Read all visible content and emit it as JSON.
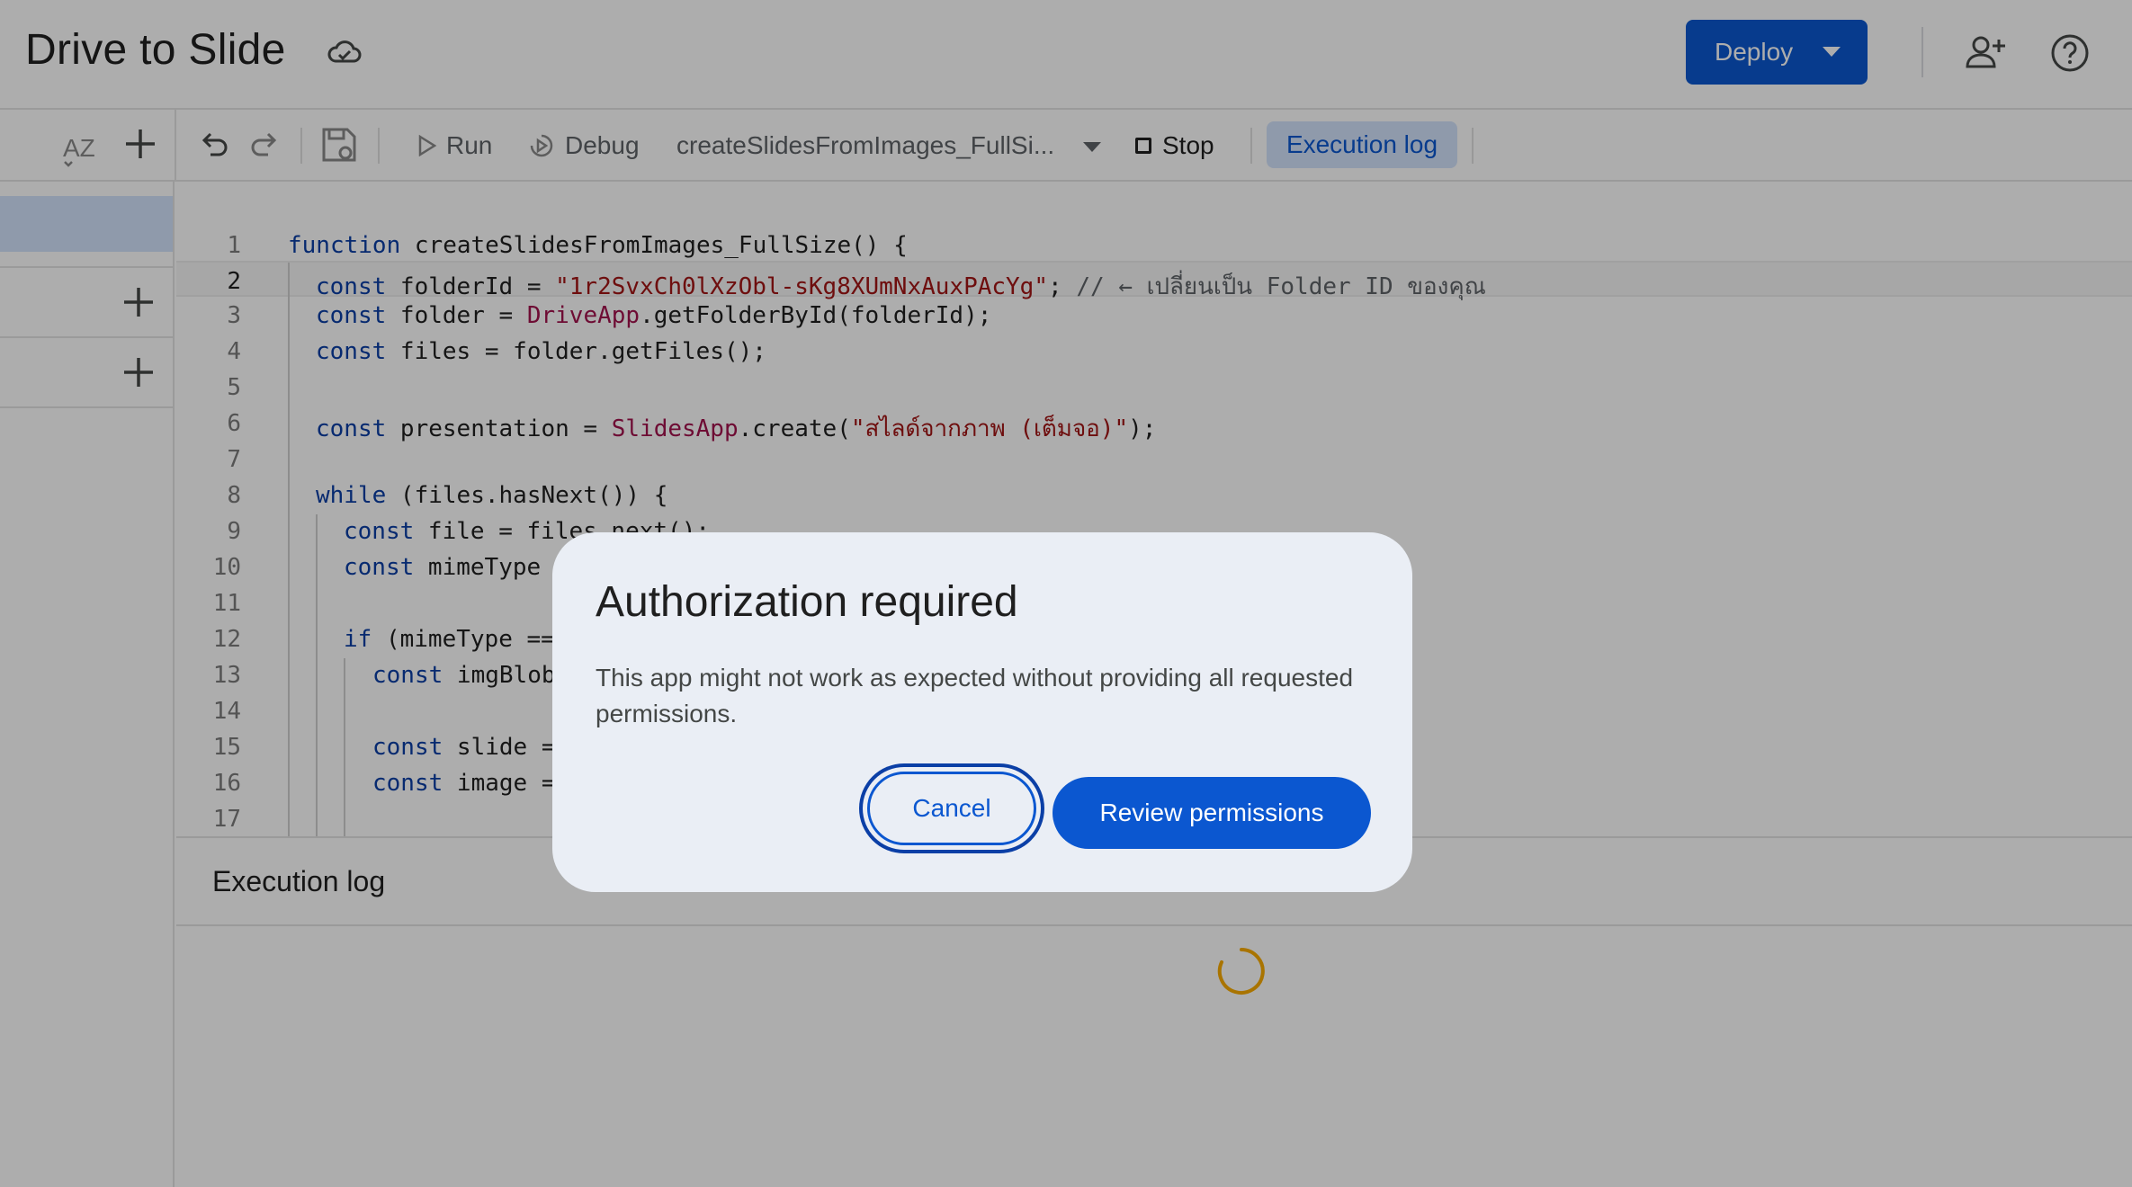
{
  "app": {
    "title": "Drive to Slide",
    "cloud_icon": "cloud-sync-icon"
  },
  "header": {
    "deploy_label": "Deploy",
    "share_icon": "person-add-icon",
    "help_icon": "help-icon"
  },
  "toolbar": {
    "run_label": "Run",
    "debug_label": "Debug",
    "function_selected": "createSlidesFromImages_FullSi...",
    "stop_label": "Stop",
    "execution_log_label": "Execution log"
  },
  "editor": {
    "line_numbers": [
      "1",
      "2",
      "3",
      "4",
      "5",
      "6",
      "7",
      "8",
      "9",
      "10",
      "11",
      "12",
      "13",
      "14",
      "15",
      "16",
      "17"
    ],
    "current_line": 2,
    "code": {
      "l1_kw": "function",
      "l1_rest": " createSlidesFromImages_FullSize() {",
      "l2_kw": "const",
      "l2_a": " folderId = ",
      "l2_str": "\"1r2SvxCh0lXzObl-sKg8XUmNxAuxPAcYg\"",
      "l2_b": "; ",
      "l2_cmt": "// ← เปลี่ยนเป็น Folder ID ของคุณ",
      "l3_kw": "const",
      "l3_a": " folder = ",
      "l3_cls": "DriveApp",
      "l3_b": ".getFolderById(folderId);",
      "l4_kw": "const",
      "l4_a": " files = folder.getFiles();",
      "l6_kw": "const",
      "l6_a": " presentation = ",
      "l6_cls": "SlidesApp",
      "l6_b": ".create(",
      "l6_str": "\"สไลด์จากภาพ (เต็มจอ)\"",
      "l6_c": ");",
      "l8_kw": "while",
      "l8_a": " (files.hasNext()) {",
      "l9_kw": "const",
      "l9_a": " file = files.next();",
      "l10_kw": "const",
      "l10_a": " mimeType",
      "l12_kw": "if",
      "l12_a": " (mimeType ==",
      "l13_kw": "const",
      "l13_a": " imgBlob",
      "l15_kw": "const",
      "l15_a": " slide =",
      "l16_kw": "const",
      "l16_a": " image ="
    }
  },
  "log": {
    "title": "Execution log"
  },
  "dialog": {
    "title": "Authorization required",
    "body": "This app might not work as expected without providing all requested permissions.",
    "cancel_label": "Cancel",
    "review_label": "Review permissions"
  },
  "colors": {
    "accent": "#0b57d0",
    "accent_light": "#d3e3fd",
    "dialog_bg": "#eaeef5",
    "spinner": "#f9ab00"
  }
}
